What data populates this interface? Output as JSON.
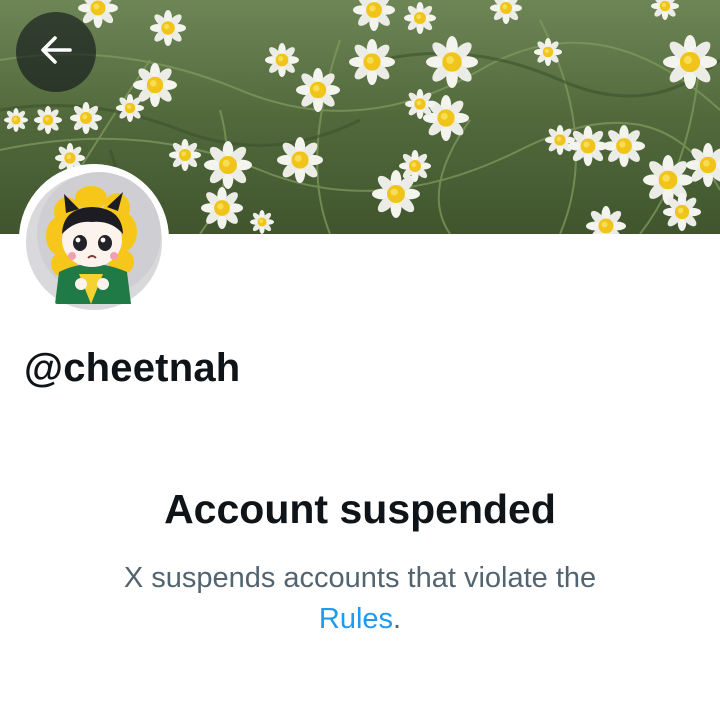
{
  "profile": {
    "handle": "@cheetnah",
    "banner_description": "daisy-meadow-banner",
    "avatar_description": "plush-doll-avatar"
  },
  "navigation": {
    "back_icon": "arrow-left-icon"
  },
  "suspension_notice": {
    "title": "Account suspended",
    "message": "X suspends accounts that violate the",
    "link_label": "Rules",
    "trailing": "."
  },
  "colors": {
    "text_primary": "#0f1419",
    "text_secondary": "#536471",
    "link": "#1d9bf0",
    "back_button_bg": "#0f1419"
  }
}
